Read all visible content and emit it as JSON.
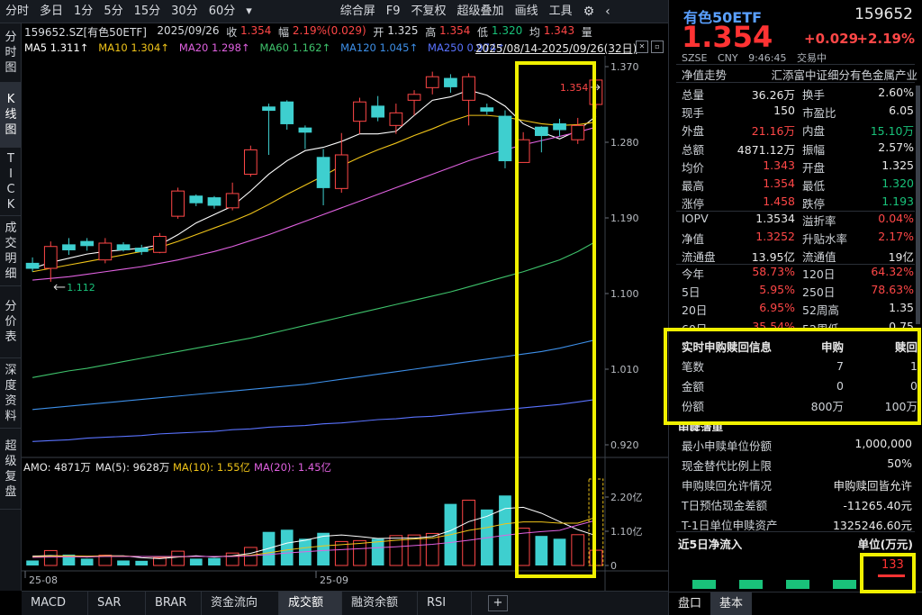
{
  "toolbar": {
    "items": [
      "分时",
      "多日",
      "1分",
      "5分",
      "15分",
      "30分",
      "60分",
      "▾"
    ],
    "right_items": [
      "综合屏",
      "F9",
      "不复权",
      "超级叠加",
      "画线",
      "工具"
    ],
    "gear": "⚙",
    "arrow": "‹"
  },
  "left_tabs": [
    {
      "label": "分时图",
      "active": false
    },
    {
      "label": "K线图",
      "active": true
    },
    {
      "label": "TICK",
      "active": false
    },
    {
      "label": "成交明细",
      "active": false
    },
    {
      "label": "分价表",
      "active": false
    },
    {
      "label": "深度资料",
      "active": false
    },
    {
      "label": "超级复盘",
      "active": false
    }
  ],
  "info": {
    "symbol": "159652.SZ[有色50ETF]",
    "date": "2025/09/26",
    "close_label": "收",
    "close": "1.354",
    "change_label": "幅",
    "change": "2.19%(0.029)",
    "open_label": "开",
    "open": "1.325",
    "high_label": "高",
    "high": "1.354",
    "low_label": "低",
    "low": "1.320",
    "avg_label": "均",
    "avg": "1.343",
    "vol_label": "量"
  },
  "ma": {
    "ma5": "MA5 1.311↑",
    "ma10": "MA10 1.304↑",
    "ma20": "MA20 1.298↑",
    "ma60": "MA60 1.162↑",
    "ma120": "MA120 1.045↑",
    "ma250": "MA250 0.974↑"
  },
  "date_range": "2025/08/14-2025/09/26(32日)",
  "chart_labels": {
    "high_mark": "1.354",
    "low_mark": "1.112",
    "price_axis": [
      "1.370",
      "1.280",
      "1.190",
      "1.100",
      "1.010",
      "0.920"
    ],
    "vol_axis": [
      "2.20亿",
      "1.10亿",
      "0"
    ],
    "date_axis": [
      "25-08",
      "25-09"
    ],
    "amo": "AMO: 4871万",
    "amo_ma5": "MA(5): 9628万",
    "amo_ma10": "MA(10): 1.55亿",
    "amo_ma20": "MA(20): 1.45亿"
  },
  "chart_data": {
    "type": "candlestick",
    "price_ylim": [
      0.92,
      1.37
    ],
    "vol_ylim": [
      0,
      2.2
    ],
    "vol_unit": "亿",
    "candles": [
      {
        "o": 1.136,
        "c": 1.13,
        "h": 1.143,
        "l": 1.126,
        "v": 0.16
      },
      {
        "o": 1.13,
        "c": 1.156,
        "h": 1.162,
        "l": 1.114,
        "v": 0.48
      },
      {
        "o": 1.158,
        "c": 1.152,
        "h": 1.166,
        "l": 1.146,
        "v": 0.35
      },
      {
        "o": 1.162,
        "c": 1.157,
        "h": 1.166,
        "l": 1.151,
        "v": 0.22
      },
      {
        "o": 1.14,
        "c": 1.16,
        "h": 1.166,
        "l": 1.136,
        "v": 0.33
      },
      {
        "o": 1.158,
        "c": 1.152,
        "h": 1.161,
        "l": 1.15,
        "v": 0.16
      },
      {
        "o": 1.154,
        "c": 1.15,
        "h": 1.158,
        "l": 1.146,
        "v": 0.15
      },
      {
        "o": 1.149,
        "c": 1.168,
        "h": 1.172,
        "l": 1.148,
        "v": 0.25
      },
      {
        "o": 1.192,
        "c": 1.222,
        "h": 1.226,
        "l": 1.189,
        "v": 0.46
      },
      {
        "o": 1.216,
        "c": 1.208,
        "h": 1.218,
        "l": 1.204,
        "v": 0.22
      },
      {
        "o": 1.214,
        "c": 1.205,
        "h": 1.216,
        "l": 1.201,
        "v": 0.24
      },
      {
        "o": 1.202,
        "c": 1.219,
        "h": 1.232,
        "l": 1.199,
        "v": 0.4
      },
      {
        "o": 1.242,
        "c": 1.271,
        "h": 1.276,
        "l": 1.239,
        "v": 0.58
      },
      {
        "o": 1.322,
        "c": 1.318,
        "h": 1.326,
        "l": 1.265,
        "v": 1.08
      },
      {
        "o": 1.328,
        "c": 1.302,
        "h": 1.33,
        "l": 1.295,
        "v": 1.15
      },
      {
        "o": 1.297,
        "c": 1.292,
        "h": 1.3,
        "l": 1.272,
        "v": 0.86
      },
      {
        "o": 1.262,
        "c": 1.226,
        "h": 1.272,
        "l": 1.205,
        "v": 1.05
      },
      {
        "o": 1.225,
        "c": 1.265,
        "h": 1.291,
        "l": 1.22,
        "v": 0.77
      },
      {
        "o": 1.305,
        "c": 1.328,
        "h": 1.333,
        "l": 1.29,
        "v": 0.8
      },
      {
        "o": 1.323,
        "c": 1.31,
        "h": 1.335,
        "l": 1.305,
        "v": 0.86
      },
      {
        "o": 1.3,
        "c": 1.315,
        "h": 1.326,
        "l": 1.29,
        "v": 0.96
      },
      {
        "o": 1.33,
        "c": 1.337,
        "h": 1.342,
        "l": 1.312,
        "v": 0.98
      },
      {
        "o": 1.345,
        "c": 1.358,
        "h": 1.364,
        "l": 1.337,
        "v": 1.03
      },
      {
        "o": 1.356,
        "c": 1.346,
        "h": 1.361,
        "l": 1.339,
        "v": 1.98
      },
      {
        "o": 1.33,
        "c": 1.358,
        "h": 1.362,
        "l": 1.3,
        "v": 2.1
      },
      {
        "o": 1.321,
        "c": 1.317,
        "h": 1.326,
        "l": 1.313,
        "v": 1.8
      },
      {
        "o": 1.311,
        "c": 1.258,
        "h": 1.318,
        "l": 1.249,
        "v": 2.25
      },
      {
        "o": 1.256,
        "c": 1.283,
        "h": 1.292,
        "l": 1.26,
        "v": 1.2
      },
      {
        "o": 1.298,
        "c": 1.288,
        "h": 1.299,
        "l": 1.268,
        "v": 0.95
      },
      {
        "o": 1.302,
        "c": 1.295,
        "h": 1.308,
        "l": 1.287,
        "v": 0.86
      },
      {
        "o": 1.283,
        "c": 1.3,
        "h": 1.309,
        "l": 1.278,
        "v": 0.99
      },
      {
        "o": 1.325,
        "c": 1.354,
        "h": 1.354,
        "l": 1.32,
        "v": 0.49
      }
    ],
    "ma_lines": [
      {
        "name": "MA5",
        "color": "#ffffff",
        "values": [
          1.13,
          1.137,
          1.142,
          1.147,
          1.15,
          1.152,
          1.154,
          1.158,
          1.17,
          1.184,
          1.194,
          1.204,
          1.222,
          1.242,
          1.258,
          1.27,
          1.274,
          1.281,
          1.29,
          1.29,
          1.293,
          1.312,
          1.33,
          1.334,
          1.342,
          1.336,
          1.323,
          1.302,
          1.292,
          1.284,
          1.294,
          1.311
        ]
      },
      {
        "name": "MA10",
        "color": "#f0c419",
        "values": [
          1.126,
          1.13,
          1.134,
          1.138,
          1.142,
          1.146,
          1.15,
          1.155,
          1.162,
          1.17,
          1.178,
          1.186,
          1.195,
          1.206,
          1.218,
          1.229,
          1.24,
          1.252,
          1.262,
          1.271,
          1.279,
          1.288,
          1.296,
          1.305,
          1.312,
          1.312,
          1.31,
          1.306,
          1.302,
          1.3,
          1.301,
          1.304
        ]
      },
      {
        "name": "MA20",
        "color": "#e061e0",
        "values": [
          1.116,
          1.118,
          1.12,
          1.123,
          1.126,
          1.129,
          1.132,
          1.136,
          1.14,
          1.145,
          1.15,
          1.156,
          1.163,
          1.17,
          1.178,
          1.186,
          1.194,
          1.202,
          1.21,
          1.218,
          1.226,
          1.234,
          1.242,
          1.25,
          1.258,
          1.265,
          1.271,
          1.277,
          1.282,
          1.287,
          1.292,
          1.298
        ]
      },
      {
        "name": "MA60",
        "color": "#3ec26b",
        "values": [
          1.0,
          1.004,
          1.008,
          1.011,
          1.015,
          1.019,
          1.023,
          1.027,
          1.031,
          1.035,
          1.039,
          1.043,
          1.047,
          1.052,
          1.057,
          1.062,
          1.067,
          1.072,
          1.077,
          1.082,
          1.087,
          1.092,
          1.097,
          1.102,
          1.108,
          1.114,
          1.12,
          1.126,
          1.133,
          1.14,
          1.15,
          1.162
        ]
      },
      {
        "name": "MA120",
        "color": "#3d8fe8",
        "values": [
          0.962,
          0.964,
          0.966,
          0.968,
          0.97,
          0.972,
          0.974,
          0.976,
          0.978,
          0.98,
          0.982,
          0.984,
          0.986,
          0.988,
          0.99,
          0.992,
          0.995,
          0.998,
          1.001,
          1.004,
          1.007,
          1.01,
          1.013,
          1.016,
          1.019,
          1.022,
          1.025,
          1.028,
          1.031,
          1.035,
          1.04,
          1.045
        ]
      },
      {
        "name": "MA250",
        "color": "#5a73ff",
        "values": [
          0.924,
          0.925,
          0.926,
          0.928,
          0.929,
          0.93,
          0.931,
          0.933,
          0.934,
          0.935,
          0.936,
          0.938,
          0.939,
          0.941,
          0.942,
          0.943,
          0.945,
          0.946,
          0.948,
          0.95,
          0.951,
          0.953,
          0.954,
          0.956,
          0.958,
          0.96,
          0.962,
          0.964,
          0.966,
          0.968,
          0.971,
          0.974
        ]
      }
    ],
    "vol_ma_lines": [
      {
        "name": "MA(5)",
        "color": "#ffffff",
        "values": [
          0.3,
          0.32,
          0.3,
          0.27,
          0.31,
          0.31,
          0.25,
          0.22,
          0.27,
          0.31,
          0.27,
          0.31,
          0.39,
          0.55,
          0.72,
          0.81,
          0.94,
          0.98,
          0.93,
          0.87,
          0.88,
          0.88,
          0.93,
          1.12,
          1.41,
          1.58,
          1.83,
          1.87,
          1.68,
          1.41,
          1.15,
          0.96
        ]
      },
      {
        "name": "MA(10)",
        "color": "#f0c419",
        "values": [
          0.28,
          0.3,
          0.31,
          0.3,
          0.31,
          0.3,
          0.29,
          0.28,
          0.28,
          0.29,
          0.29,
          0.3,
          0.33,
          0.41,
          0.5,
          0.57,
          0.63,
          0.67,
          0.71,
          0.76,
          0.81,
          0.85,
          0.88,
          0.99,
          1.13,
          1.22,
          1.34,
          1.4,
          1.4,
          1.36,
          1.36,
          1.55
        ]
      },
      {
        "name": "MA(20)",
        "color": "#e061e0",
        "values": [
          0.26,
          0.27,
          0.28,
          0.28,
          0.29,
          0.29,
          0.29,
          0.29,
          0.29,
          0.29,
          0.29,
          0.29,
          0.31,
          0.35,
          0.4,
          0.44,
          0.48,
          0.51,
          0.54,
          0.57,
          0.6,
          0.64,
          0.68,
          0.74,
          0.81,
          0.89,
          0.97,
          1.04,
          1.09,
          1.13,
          1.3,
          1.45
        ]
      }
    ]
  },
  "right": {
    "name": "有色50ETF",
    "code": "159652",
    "price": "1.354",
    "change": "+0.029",
    "pct": "+2.19%",
    "meta": [
      "SZSE",
      "CNY",
      "9:46:45",
      "交易中"
    ],
    "trend_label": "净值走势",
    "trend_desc": "汇添富中证细分有色金属产业",
    "stats": [
      {
        "k1": "总量",
        "v1": "36.26万",
        "c1": "w",
        "k2": "换手",
        "v2": "2.60%",
        "c2": "w"
      },
      {
        "k1": "现手",
        "v1": "150",
        "c1": "w",
        "k2": "市盈比",
        "v2": "6.05",
        "c2": "w"
      },
      {
        "k1": "外盘",
        "v1": "21.16万",
        "c1": "r",
        "k2": "内盘",
        "v2": "15.10万",
        "c2": "g"
      },
      {
        "k1": "总额",
        "v1": "4871.12万",
        "c1": "w",
        "k2": "振幅",
        "v2": "2.57%",
        "c2": "w"
      },
      {
        "k1": "均价",
        "v1": "1.343",
        "c1": "r",
        "k2": "开盘",
        "v2": "1.325",
        "c2": "w"
      },
      {
        "k1": "最高",
        "v1": "1.354",
        "c1": "r",
        "k2": "最低",
        "v2": "1.320",
        "c2": "g"
      },
      {
        "k1": "涨停",
        "v1": "1.458",
        "c1": "r",
        "k2": "跌停",
        "v2": "1.193",
        "c2": "g"
      }
    ],
    "stats2": [
      {
        "k1": "IOPV",
        "v1": "1.3534",
        "c1": "w",
        "k2": "溢折率",
        "v2": "0.04%",
        "c2": "r"
      },
      {
        "k1": "净值",
        "v1": "1.3252",
        "c1": "r",
        "k2": "升贴水率",
        "v2": "2.17%",
        "c2": "r"
      },
      {
        "k1": "流通盘",
        "v1": "13.95亿",
        "c1": "w",
        "k2": "流通值",
        "v2": "19亿",
        "c2": "w"
      }
    ],
    "stats3": [
      {
        "k1": "今年",
        "v1": "58.73%",
        "c1": "r",
        "k2": "120日",
        "v2": "64.32%",
        "c2": "r"
      },
      {
        "k1": "5日",
        "v1": "5.95%",
        "c1": "r",
        "k2": "250日",
        "v2": "78.63%",
        "c2": "r"
      },
      {
        "k1": "20日",
        "v1": "6.95%",
        "c1": "r",
        "k2": "52周高",
        "v2": "1.35",
        "c2": "w"
      },
      {
        "k1": "60日",
        "v1": "35.54%",
        "c1": "r",
        "k2": "52周低",
        "v2": "0.75",
        "c2": "w"
      }
    ],
    "sr": {
      "title": "实时申购赎回信息",
      "col1": "申购",
      "col2": "赎回",
      "rows": [
        {
          "k": "笔数",
          "a": "7",
          "b": "1"
        },
        {
          "k": "金额",
          "a": "0",
          "b": "0"
        },
        {
          "k": "份额",
          "a": "800万",
          "b": "100万"
        }
      ]
    },
    "sub_title": "申赎清单",
    "sub": [
      {
        "k": "最小申赎单位份额",
        "v": "1,000,000"
      },
      {
        "k": "现金替代比例上限",
        "v": "50%"
      },
      {
        "k": "申购赎回允许情况",
        "v": "申购赎回皆允许"
      },
      {
        "k": "T日预估现金差额",
        "v": "-11265.40元"
      },
      {
        "k": "T-1日单位申赎资产",
        "v": "1325246.60元"
      }
    ],
    "flow_title": "近5日净流入",
    "flow_unit": "单位(万元)",
    "flow_value": "133",
    "tabs": [
      "盘口",
      "基本"
    ]
  },
  "bottom_tabs": [
    {
      "label": "MACD",
      "active": false
    },
    {
      "label": "SAR",
      "active": false
    },
    {
      "label": "BRAR",
      "active": false
    },
    {
      "label": "资金流向",
      "active": false
    },
    {
      "label": "成交额",
      "active": true
    },
    {
      "label": "融资余额",
      "active": false
    },
    {
      "label": "RSI",
      "active": false
    }
  ],
  "colors": {
    "up": "#ff4747",
    "down": "#3ecfcf",
    "highlight": "#f0f000"
  }
}
